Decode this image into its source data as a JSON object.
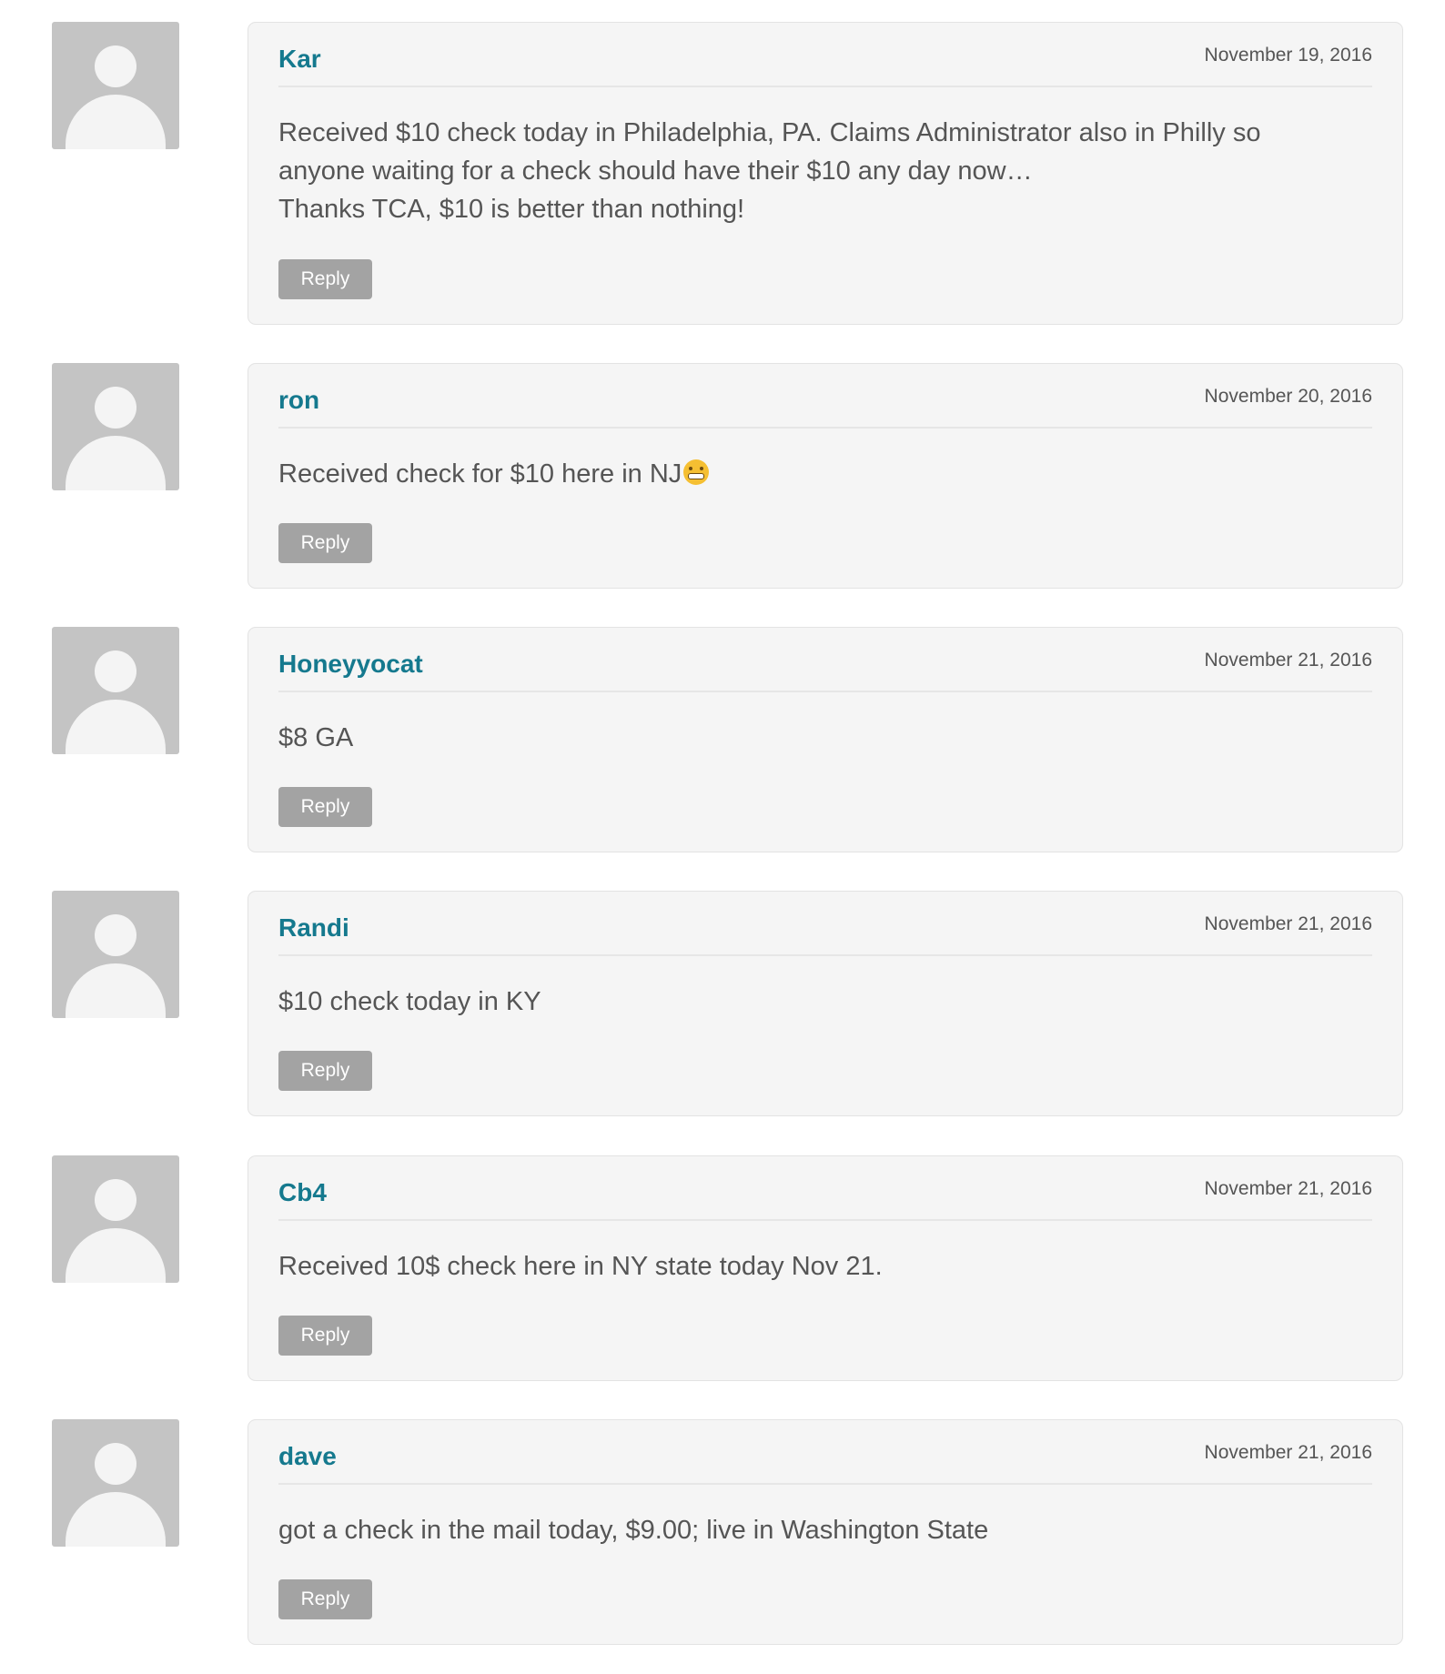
{
  "colors": {
    "author": "#15798e",
    "text": "#555555",
    "card_bg": "#f5f5f5",
    "reply_bg": "#a3a3a3",
    "avatar_bg": "#c4c4c4"
  },
  "comments": [
    {
      "author": "Kar",
      "date": "November 19, 2016",
      "lines": [
        "Received $10 check today in Philadelphia, PA. Claims Administrator also in Philly so",
        "anyone waiting for a check should have their $10 any day now…",
        "Thanks TCA, $10 is better than nothing!"
      ],
      "reply_label": "Reply"
    },
    {
      "author": "ron",
      "date": "November 20, 2016",
      "lines": [
        "Received check for $10 here in NJ"
      ],
      "emoji": "grimacing-face-emoji",
      "reply_label": "Reply"
    },
    {
      "author": "Honeyyocat",
      "date": "November 21, 2016",
      "lines": [
        "$8 GA"
      ],
      "reply_label": "Reply"
    },
    {
      "author": "Randi",
      "date": "November 21, 2016",
      "lines": [
        "$10 check today in KY"
      ],
      "reply_label": "Reply"
    },
    {
      "author": "Cb4",
      "date": "November 21, 2016",
      "lines": [
        "Received 10$ check here in NY state today Nov 21."
      ],
      "reply_label": "Reply"
    },
    {
      "author": "dave",
      "date": "November 21, 2016",
      "lines": [
        "got a check in the mail today, $9.00; live in Washington State"
      ],
      "reply_label": "Reply"
    }
  ]
}
